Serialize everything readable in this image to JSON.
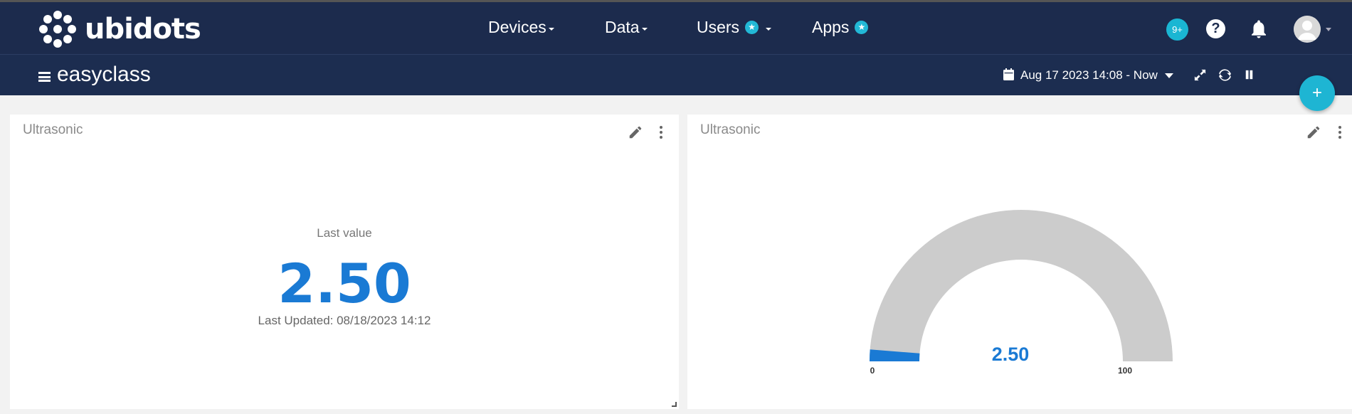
{
  "brand": {
    "name": "ubidots"
  },
  "nav": {
    "devices": "Devices",
    "data": "Data",
    "users": "Users",
    "apps": "Apps"
  },
  "header": {
    "notifications_badge": "9+",
    "help_glyph": "?"
  },
  "subbar": {
    "dashboard_title": "easyclass",
    "date_range": "Aug 17 2023 14:08 - Now"
  },
  "fab": {
    "label": "+"
  },
  "widgets": {
    "metric": {
      "title": "Ultrasonic",
      "caption": "Last value",
      "value": "2.50",
      "updated": "Last Updated: 08/18/2023 14:12"
    },
    "gauge": {
      "title": "Ultrasonic",
      "value": 2.5,
      "value_label": "2.50",
      "min_label": "0",
      "max_label": "100",
      "min": 0,
      "max": 100,
      "fill_color": "#1a7ad4",
      "track_color": "#cccccc"
    }
  },
  "colors": {
    "topbar": "#1c2b4d",
    "accent": "#1eb5d3",
    "value_blue": "#1a7ad4"
  },
  "icons": [
    "bell-icon",
    "help-icon",
    "calendar-icon",
    "expand-icon",
    "refresh-icon",
    "pause-icon",
    "pencil-icon",
    "kebab-icon",
    "hamburger-icon",
    "star-icon",
    "avatar-icon"
  ]
}
